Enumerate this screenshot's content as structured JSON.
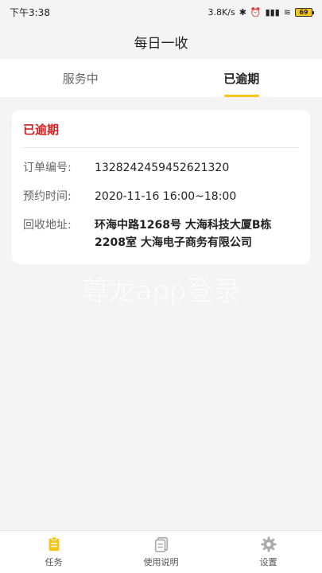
{
  "status_bar": {
    "time": "下午3:38",
    "network_speed": "3.8K/s",
    "battery": "69"
  },
  "header": {
    "title": "每日一收"
  },
  "tabs": [
    {
      "label": "服务中",
      "active": false
    },
    {
      "label": "已逾期",
      "active": true
    }
  ],
  "order": {
    "status": "已逾期",
    "fields": [
      {
        "label": "订单编号:",
        "value": "1328242459452621320"
      },
      {
        "label": "预约时间:",
        "value": "2020-11-16 16:00~18:00"
      },
      {
        "label": "回收地址:",
        "value": "环海中路1268号 大海科技大厦B栋2208室 大海电子商务有限公司"
      }
    ]
  },
  "watermark": "尊龙app登录",
  "bottom_nav": [
    {
      "label": "任务",
      "icon": "clipboard-icon",
      "active": true
    },
    {
      "label": "使用说明",
      "icon": "document-icon",
      "active": false
    },
    {
      "label": "设置",
      "icon": "gear-icon",
      "active": false
    }
  ],
  "colors": {
    "accent": "#f5c518",
    "overdue": "#d31f1f",
    "background": "#f4f4f4"
  }
}
